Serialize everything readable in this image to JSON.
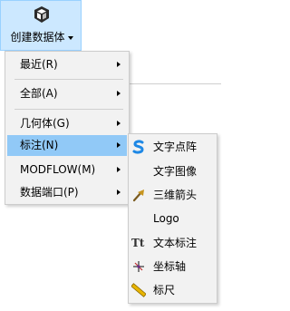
{
  "ribbon": {
    "create_button_label": "创建数据体",
    "create_button_icon": "cube-icon"
  },
  "menu": {
    "items": [
      {
        "label": "最近(R)",
        "has_submenu": true
      },
      {
        "label": "全部(A)",
        "has_submenu": true
      },
      {
        "label": "几何体(G)",
        "has_submenu": true
      },
      {
        "label": "标注(N)",
        "has_submenu": true,
        "active": true
      },
      {
        "label": "MODFLOW(M)",
        "has_submenu": true
      },
      {
        "label": "数据端口(P)",
        "has_submenu": true
      }
    ]
  },
  "submenu": {
    "items": [
      {
        "label": "文字点阵",
        "icon": "text-dot-matrix-icon"
      },
      {
        "label": "文字图像",
        "icon": ""
      },
      {
        "label": "三维箭头",
        "icon": "3d-arrow-icon"
      },
      {
        "label": "Logo",
        "icon": ""
      },
      {
        "label": "文本标注",
        "icon": "text-annotation-icon",
        "icon_text": "Tt"
      },
      {
        "label": "坐标轴",
        "icon": "axes-icon"
      },
      {
        "label": "标尺",
        "icon": "ruler-icon"
      }
    ]
  },
  "colors": {
    "ribbon_button_bg": "#cce8ff",
    "menu_bg": "#f2f2f2",
    "active_item_bg": "#91c9f7"
  }
}
